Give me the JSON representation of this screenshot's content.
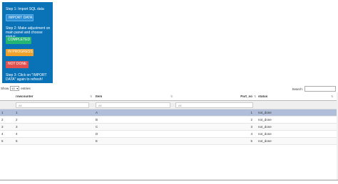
{
  "panel": {
    "step1": "Step 1: Import SQL data",
    "import_button": "IMPORT DATA",
    "step2": "Step 2: Make adjustment on main panel and choose status:",
    "completed_button": "COMPLETED",
    "in_progress_button": "IN PROGRESS",
    "not_done_button": "NOT DONE",
    "step3": "Step 3: Click on \"IMPORT DATA\" again to refresh!"
  },
  "table_controls": {
    "show_label": "Show",
    "entries_value": "10",
    "entries_label": "entries",
    "search_label": "Search:"
  },
  "table": {
    "columns": [
      "",
      "rowcounter",
      "Item",
      "Part_no",
      "status"
    ],
    "filter_placeholder": "All",
    "rows": [
      [
        "1",
        "1",
        "A",
        "1",
        "not_done"
      ],
      [
        "2",
        "2",
        "B",
        "2",
        "not_done"
      ],
      [
        "3",
        "3",
        "C",
        "3",
        "not_done"
      ],
      [
        "4",
        "4",
        "D",
        "4",
        "not_done"
      ],
      [
        "5",
        "5",
        "E",
        "5",
        "not_done"
      ]
    ]
  },
  "colors": {
    "panel_bg": "#0a73b8",
    "import": "#2d8fd5",
    "completed": "#22b573",
    "in_progress": "#f0a12a",
    "not_done": "#e05050",
    "selected_row": "#b0bed9"
  }
}
